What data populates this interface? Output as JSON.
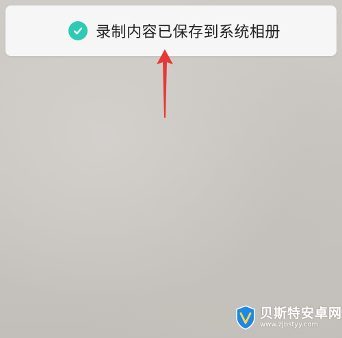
{
  "toast": {
    "message": "录制内容已保存到系统相册",
    "icon": "check-circle-icon",
    "accent_color": "#2fcab3"
  },
  "annotation": {
    "icon": "red-arrow-icon",
    "color": "#e53935"
  },
  "watermark": {
    "title": "贝斯特安卓网",
    "url": "www.zjbstyy.com",
    "icon": "shield-logo-icon"
  }
}
